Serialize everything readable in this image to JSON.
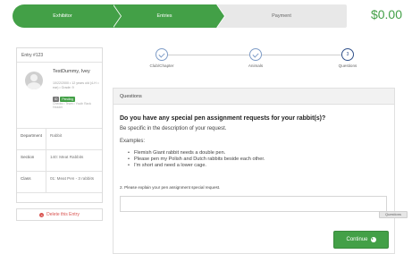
{
  "wizard": {
    "steps": [
      {
        "label": "Exhibitor",
        "state": "done"
      },
      {
        "label": "Entries",
        "state": "done"
      },
      {
        "label": "Payment",
        "state": "current"
      }
    ],
    "total": "$0.00"
  },
  "entry": {
    "title": "Entry #123",
    "exhibitor_name": "TestDummy, Ivey",
    "exhibitor_meta": "10/22/2000 • 12 years old (4-H = ear) • Grade: 9",
    "badges": [
      "ID",
      "Pending"
    ],
    "links": "Checks • Team • Youth Rank Header",
    "rows": [
      {
        "key": "Department",
        "value": "Rabbit"
      },
      {
        "key": "Section",
        "value": "140: Meat Rabbits"
      },
      {
        "key": "Class",
        "value": "01: Meat Pen - 3 rabbits"
      }
    ],
    "delete_label": "Delete this Entry"
  },
  "progress": {
    "steps": [
      {
        "label": "Club/Chapter",
        "state": "done"
      },
      {
        "label": "Animals",
        "state": "done"
      },
      {
        "label": "Questions",
        "state": "current",
        "number": "3"
      }
    ]
  },
  "questions": {
    "panel_title": "Questions",
    "heading": "Do you have any special pen assignment requests for your rabbit(s)?",
    "description": "Be specific in the description of your request.",
    "examples_label": "Examples:",
    "examples": [
      "Flemish Giant rabbit needs a double pen.",
      "Please pen my Polish and Dutch rabbits beside each other.",
      "I'm short and need a lower cage."
    ],
    "field_label": "2. Please explain your pen assignment special request.",
    "field_value": "",
    "field_placeholder": "",
    "continue_label": "Continue",
    "side_tag": "Questions"
  },
  "colors": {
    "accent_green": "#43a047",
    "step_blue": "#30508a",
    "danger_red": "#d9534f"
  }
}
